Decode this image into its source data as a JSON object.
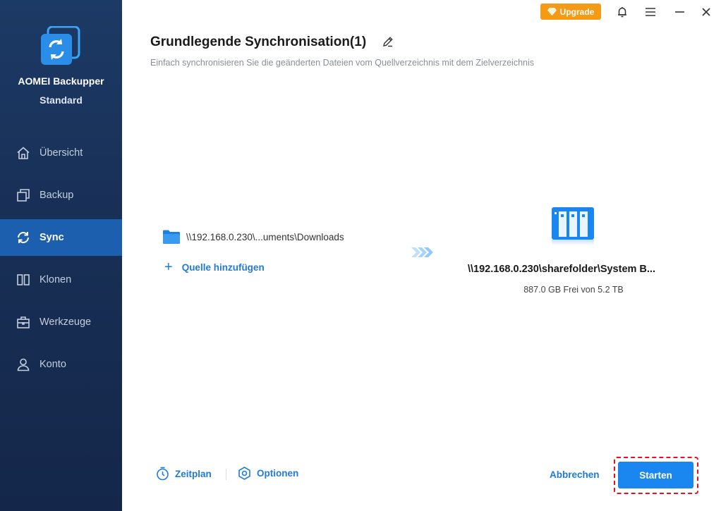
{
  "app": {
    "name_line1": "AOMEI Backupper",
    "name_line2": "Standard"
  },
  "sidebar": {
    "items": [
      {
        "label": "Übersicht",
        "icon": "home-icon",
        "active": false
      },
      {
        "label": "Backup",
        "icon": "backup-icon",
        "active": false
      },
      {
        "label": "Sync",
        "icon": "sync-icon",
        "active": true
      },
      {
        "label": "Klonen",
        "icon": "clone-icon",
        "active": false
      },
      {
        "label": "Werkzeuge",
        "icon": "toolbox-icon",
        "active": false
      },
      {
        "label": "Konto",
        "icon": "user-icon",
        "active": false
      }
    ]
  },
  "titlebar": {
    "upgrade_label": "Upgrade"
  },
  "page": {
    "title": "Grundlegende Synchronisation(1)",
    "subtitle": "Einfach synchronisieren Sie die geänderten Dateien vom Quellverzeichnis mit dem Zielverzeichnis"
  },
  "source": {
    "path": "\\\\192.168.0.230\\...uments\\Downloads",
    "add_label": "Quelle hinzufügen"
  },
  "destination": {
    "path": "\\\\192.168.0.230\\sharefolder\\System B...",
    "free_space": "887.0 GB Frei von 5.2 TB"
  },
  "footer": {
    "schedule_label": "Zeitplan",
    "options_label": "Optionen",
    "cancel_label": "Abbrechen",
    "start_label": "Starten"
  },
  "colors": {
    "sidebar_bg": "#182f55",
    "sidebar_active": "#1c5fae",
    "accent": "#1f7ad9",
    "upgrade": "#f59a14",
    "start": "#1a87f0",
    "highlight": "#e0141b"
  }
}
